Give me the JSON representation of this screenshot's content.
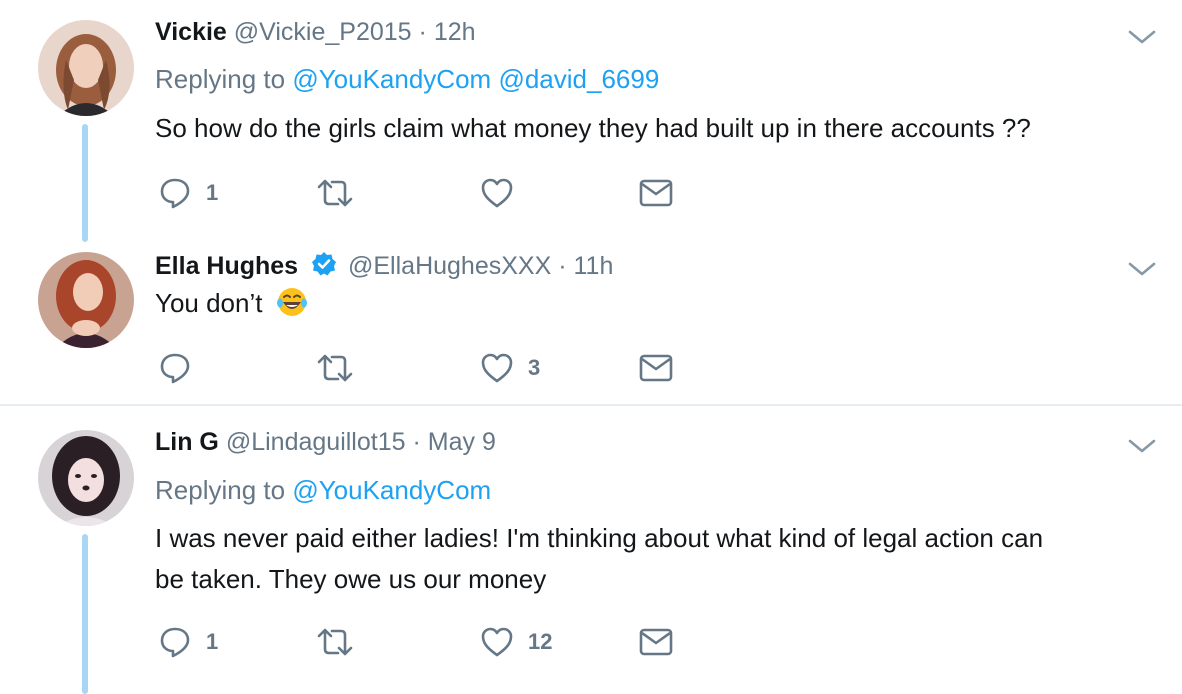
{
  "tweets": [
    {
      "name": "Vickie",
      "handle": "@Vickie_P2015",
      "separator": "·",
      "time": "12h",
      "replying_prefix": "Replying to",
      "replying_to": [
        "@YouKandyCom",
        "@david_6699"
      ],
      "text": "So how do the girls claim what money they had built up in there accounts ??",
      "reply_count": "1",
      "retweet_count": "",
      "like_count": "",
      "avatar_color": "#d9b8a8"
    },
    {
      "name": "Ella Hughes",
      "verified": true,
      "handle": "@EllaHughesXXX",
      "separator": "·",
      "time": "11h",
      "text": "You don’t",
      "emoji": "tears-of-joy-emoji",
      "reply_count": "",
      "retweet_count": "",
      "like_count": "3",
      "avatar_color": "#b5614a"
    },
    {
      "name": "Lin G",
      "handle": "@Lindaguillot15",
      "separator": "·",
      "time": "May 9",
      "replying_prefix": "Replying to",
      "replying_to": [
        "@YouKandyCom"
      ],
      "text_lines": [
        "I was never paid either ladies! I'm thinking about what kind of legal action can",
        "be taken. They owe us our money"
      ],
      "reply_count": "1",
      "retweet_count": "",
      "like_count": "12",
      "avatar_color": "#5a4a52"
    }
  ],
  "colors": {
    "mention": "#1da1f2",
    "secondary_text": "#657786",
    "thread_line": "#a9d6f5",
    "verified": "#1da1f2",
    "divider": "#e6ecf0"
  },
  "icons": [
    "reply-icon",
    "retweet-icon",
    "like-icon",
    "direct-message-icon",
    "chevron-down-icon",
    "verified-badge-icon"
  ]
}
